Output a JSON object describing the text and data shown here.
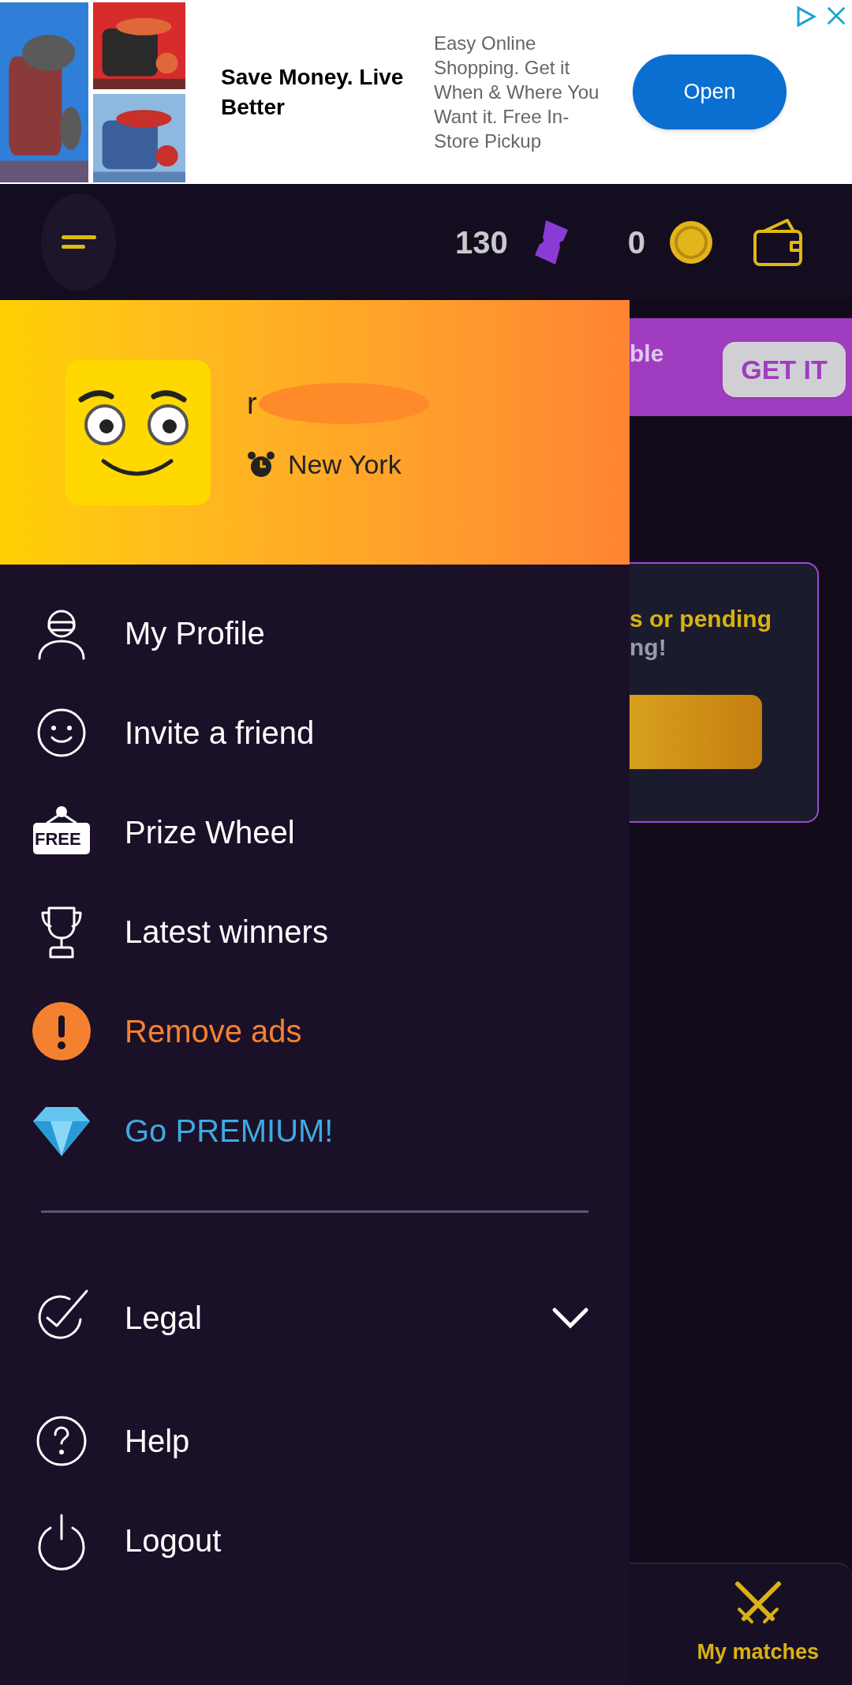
{
  "ad": {
    "title": "Save Money. Live Better",
    "description": "Easy Online Shopping. Get it When & Where You Want it. Free In-Store Pickup",
    "button": "Open"
  },
  "header": {
    "tickets": "130",
    "coins": "0"
  },
  "profile": {
    "name": "r",
    "location": "New York"
  },
  "menu": [
    {
      "kind": "normal",
      "label": "My Profile"
    },
    {
      "kind": "normal",
      "label": "Invite a friend"
    },
    {
      "kind": "normal",
      "label": "Prize Wheel",
      "badge": "FREE"
    },
    {
      "kind": "normal",
      "label": "Latest winners"
    },
    {
      "kind": "warning",
      "label": "Remove ads"
    },
    {
      "kind": "premium",
      "label": "Go PREMIUM!"
    }
  ],
  "menu_bottom": [
    {
      "kind": "expandable",
      "label": "Legal",
      "expanded": false
    },
    {
      "kind": "normal",
      "label": "Help"
    },
    {
      "kind": "normal",
      "label": "Logout"
    }
  ],
  "background": {
    "banner_text": "ble",
    "banner_button": "GET IT",
    "card_line_1": "s or pending",
    "card_line_2": "ng!",
    "nav_label": "My matches"
  }
}
